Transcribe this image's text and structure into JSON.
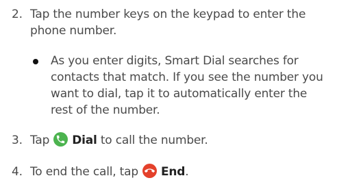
{
  "steps": [
    {
      "number": "2.",
      "lines": [
        "Tap the number keys on the keypad to enter the",
        "phone number."
      ]
    },
    {
      "number": "3.",
      "prefix": "Tap",
      "icon": "phone-call-icon",
      "label": "Dial",
      "suffix": " to call the number."
    },
    {
      "number": "4.",
      "prefix": "To end the call, tap",
      "icon": "end-call-icon",
      "label": "End",
      "suffix": "."
    }
  ],
  "bullet": {
    "lines": [
      "As you enter digits, Smart Dial searches for",
      "contacts that match. If you see the number you",
      "want to dial, tap it to automatically enter the",
      "rest of the number."
    ]
  },
  "colors": {
    "dial_icon": "#4cb34f",
    "end_icon": "#e4412b",
    "text": "#4a4a4a"
  }
}
